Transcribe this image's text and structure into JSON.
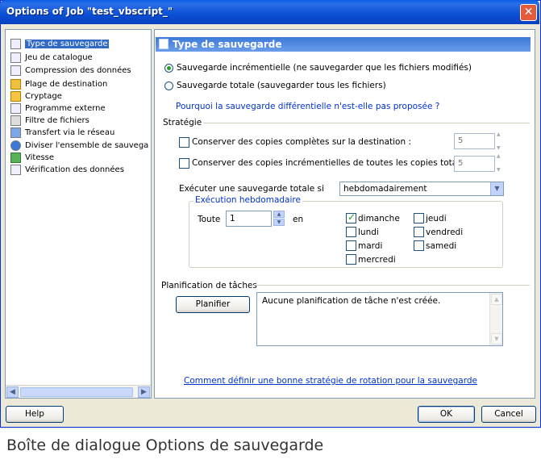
{
  "window": {
    "title": "Options of Job \"test_vbscript_\""
  },
  "tree": {
    "items": [
      {
        "label": "Type de sauvegarde",
        "icon": "doc-icon",
        "selected": true
      },
      {
        "label": "Jeu de catalogue",
        "icon": "catalog-icon"
      },
      {
        "label": "Compression des données",
        "icon": "compress-icon"
      },
      {
        "label": "Plage de destination",
        "icon": "folder-icon"
      },
      {
        "label": "Cryptage",
        "icon": "lock-icon"
      },
      {
        "label": "Programme externe",
        "icon": "program-icon"
      },
      {
        "label": "Filtre de fichiers",
        "icon": "filter-icon"
      },
      {
        "label": "Transfert via le réseau",
        "icon": "network-icon"
      },
      {
        "label": "Diviser l'ensemble de sauvega",
        "icon": "split-icon"
      },
      {
        "label": "Vitesse",
        "icon": "speed-icon"
      },
      {
        "label": "Vérification des données",
        "icon": "verify-icon"
      }
    ]
  },
  "panel": {
    "header": "Type de sauvegarde",
    "radio_incremental": "Sauvegarde incrémentielle (ne sauvegarder que les fichiers modifiés)",
    "radio_full": "Sauvegarde totale (sauvegarder tous les fichiers)",
    "link_why": "Pourquoi la sauvegarde différentielle n'est-elle pas proposée ?",
    "strategy": {
      "title": "Stratégie",
      "keep_full_label": "Conserver des copies complètes sur la destination :",
      "keep_full_value": "5",
      "keep_incr_label": "Conserver des copies incrémentielles de toutes les copies totales :",
      "keep_incr_value": "5",
      "run_full_label": "Exécuter une sauvegarde totale si",
      "run_full_value": "hebdomadairement",
      "weekly": {
        "title": "Exécution hebdomadaire",
        "every_label": "Toute",
        "every_value": "1",
        "in_label": "en",
        "days": {
          "dimanche": {
            "label": "dimanche",
            "checked": true
          },
          "lundi": {
            "label": "lundi",
            "checked": false
          },
          "mardi": {
            "label": "mardi",
            "checked": false
          },
          "mercredi": {
            "label": "mercredi",
            "checked": false
          },
          "jeudi": {
            "label": "jeudi",
            "checked": false
          },
          "vendredi": {
            "label": "vendredi",
            "checked": false
          },
          "samedi": {
            "label": "samedi",
            "checked": false
          }
        }
      }
    },
    "planning": {
      "title": "Planification de tâches",
      "button": "Planifier",
      "text": "Aucune planification de tâche n'est créée."
    },
    "link_rotation": "Comment définir une bonne stratégie de rotation pour la sauvegarde"
  },
  "footer": {
    "help": "Help",
    "ok": "OK",
    "cancel": "Cancel"
  },
  "caption": "Boîte de dialogue Options de sauvegarde"
}
